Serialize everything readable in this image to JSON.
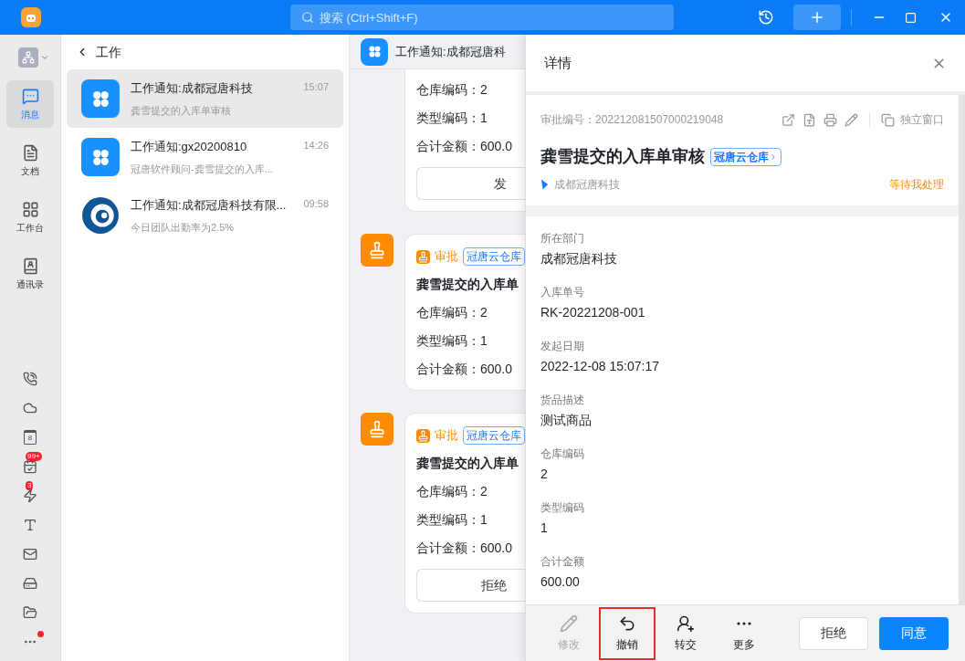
{
  "topbar": {
    "search_placeholder": "搜索 (Ctrl+Shift+F)"
  },
  "rail": {
    "items": [
      {
        "kind": "messages",
        "label": "消息",
        "selected": true
      },
      {
        "kind": "docs",
        "label": "文档",
        "selected": false
      },
      {
        "kind": "workbench",
        "label": "工作台",
        "selected": false
      },
      {
        "kind": "contacts",
        "label": "通讯录",
        "selected": false
      }
    ],
    "tools": [
      {
        "kind": "phone"
      },
      {
        "kind": "cloud"
      },
      {
        "kind": "calendar",
        "icon_text": "8"
      },
      {
        "kind": "todo",
        "badge": "99+"
      },
      {
        "kind": "flash",
        "badge": "3"
      },
      {
        "kind": "text"
      },
      {
        "kind": "mail"
      },
      {
        "kind": "drive"
      },
      {
        "kind": "folder"
      },
      {
        "kind": "more",
        "dot": true
      }
    ]
  },
  "list": {
    "title": "工作",
    "items": [
      {
        "kind": "app",
        "title": "工作通知:成都冠唐科技",
        "time": "15:07",
        "preview": "龚雪提交的入库单审核",
        "selected": true
      },
      {
        "kind": "app",
        "title": "工作通知:gx20200810",
        "time": "14:26",
        "preview": "冠唐软件顾问-龚雪提交的入库...",
        "selected": false
      },
      {
        "kind": "logo",
        "title": "工作通知:成都冠唐科技有限...",
        "time": "09:58",
        "preview": "今日团队出勤率为2.5%",
        "selected": false
      }
    ]
  },
  "chat": {
    "title": "工作通知:成都冠唐科",
    "cards": [
      {
        "avatar": false,
        "lines": [
          "仓库编码：2",
          "类型编码：1",
          "合计金额：600.0"
        ],
        "button": "发"
      },
      {
        "avatar": true,
        "type": "审批",
        "tag": "冠唐云仓库",
        "title": "龚雪提交的入库单",
        "lines": [
          "仓库编码：2",
          "类型编码：1",
          "合计金额：600.0"
        ]
      },
      {
        "avatar": true,
        "type": "审批",
        "tag": "冠唐云仓库",
        "title": "龚雪提交的入库单",
        "lines": [
          "仓库编码：2",
          "类型编码：1",
          "合计金额：600.0"
        ],
        "button": "拒绝"
      }
    ]
  },
  "detail": {
    "title": "详情",
    "serial": "审批编号：202212081507000219048",
    "open_window": "独立窗口",
    "heading": "龚雪提交的入库单审核",
    "tag": "冠唐云仓库",
    "org": "成都冠唐科技",
    "status": "等待我处理",
    "fields": [
      {
        "label": "所在部门",
        "value": "成都冠唐科技"
      },
      {
        "label": "入库单号",
        "value": "RK-20221208-001"
      },
      {
        "label": "发起日期",
        "value": "2022-12-08 15:07:17"
      },
      {
        "label": "货品描述",
        "value": "测试商品"
      },
      {
        "label": "仓库编码",
        "value": "2"
      },
      {
        "label": "类型编码",
        "value": "1"
      },
      {
        "label": "合计金额",
        "value": "600.00"
      }
    ],
    "actions": [
      {
        "kind": "edit",
        "label": "修改",
        "disabled": true,
        "highlighted": false
      },
      {
        "kind": "undo",
        "label": "撤销",
        "disabled": false,
        "highlighted": true
      },
      {
        "kind": "transfer",
        "label": "转交",
        "disabled": false,
        "highlighted": false
      },
      {
        "kind": "more",
        "label": "更多",
        "disabled": false,
        "highlighted": false
      }
    ],
    "reject": "拒绝",
    "approve": "同意"
  }
}
